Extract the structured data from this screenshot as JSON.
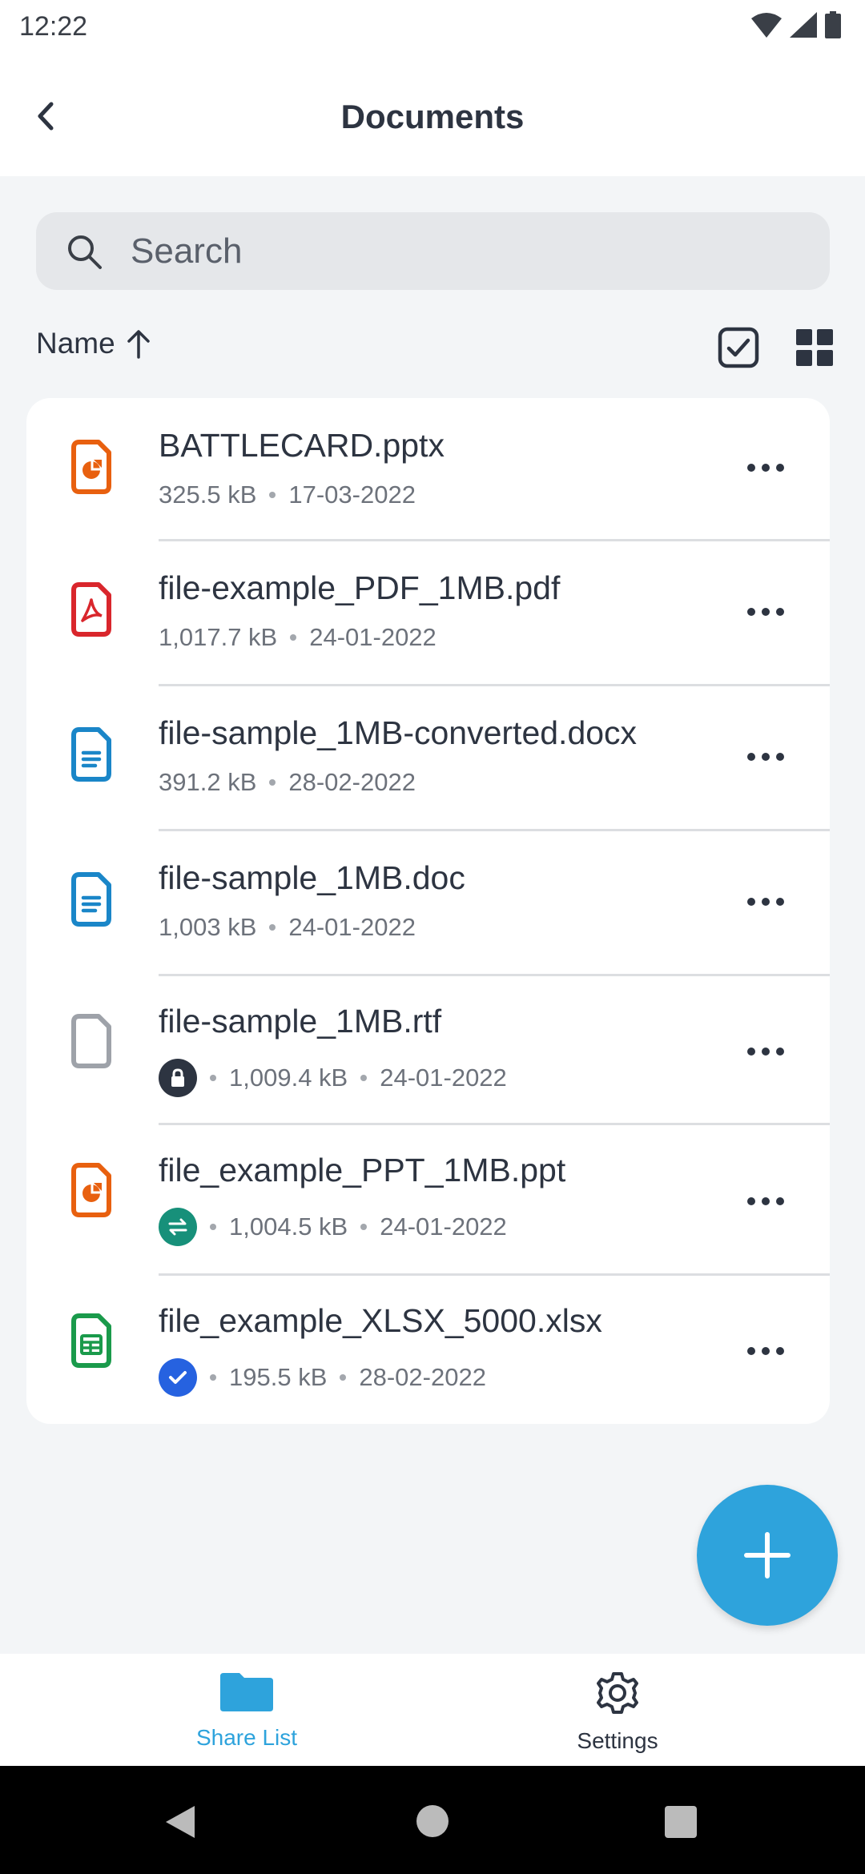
{
  "status_bar": {
    "time": "12:22"
  },
  "header": {
    "title": "Documents"
  },
  "search": {
    "placeholder": "Search"
  },
  "sort": {
    "label": "Name",
    "direction": "ascending"
  },
  "files": [
    {
      "name": "BATTLECARD.pptx",
      "size": "325.5 kB",
      "date": "17-03-2022",
      "type": "presentation",
      "badge": null
    },
    {
      "name": "file-example_PDF_1MB.pdf",
      "size": "1,017.7 kB",
      "date": "24-01-2022",
      "type": "pdf",
      "badge": null
    },
    {
      "name": "file-sample_1MB-converted.docx",
      "size": "391.2 kB",
      "date": "28-02-2022",
      "type": "document",
      "badge": null
    },
    {
      "name": "file-sample_1MB.doc",
      "size": "1,003 kB",
      "date": "24-01-2022",
      "type": "document",
      "badge": null
    },
    {
      "name": "file-sample_1MB.rtf",
      "size": "1,009.4 kB",
      "date": "24-01-2022",
      "type": "generic",
      "badge": "lock"
    },
    {
      "name": "file_example_PPT_1MB.ppt",
      "size": "1,004.5 kB",
      "date": "24-01-2022",
      "type": "presentation",
      "badge": "sync"
    },
    {
      "name": "file_example_XLSX_5000.xlsx",
      "size": "195.5 kB",
      "date": "28-02-2022",
      "type": "spreadsheet",
      "badge": "check"
    }
  ],
  "bottom_nav": {
    "items": [
      {
        "label": "Share List",
        "active": true
      },
      {
        "label": "Settings",
        "active": false
      }
    ]
  },
  "colors": {
    "accent": "#2ea3dc",
    "presentation": "#e8600f",
    "pdf": "#d9262c",
    "document": "#1a86c8",
    "generic": "#9ea2a9",
    "spreadsheet": "#1a9a4b",
    "lock": "#2d3441",
    "sync": "#17907a",
    "check": "#2662e0"
  }
}
